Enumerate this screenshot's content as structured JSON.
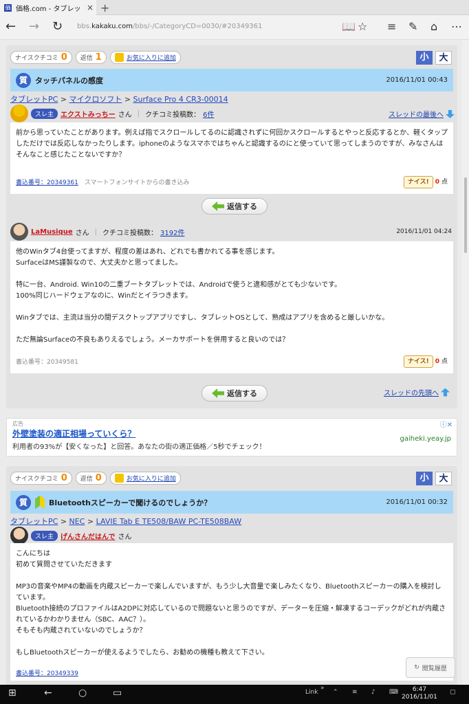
{
  "browser": {
    "tab_title": "価格.com - タブレットPCの",
    "favicon": "価",
    "tab_close": "×",
    "new_tab": "+",
    "url_prefix": "bbs.",
    "url_host": "kakaku.com",
    "url_path": "/bbs/-/CategoryCD=0030/#20349361"
  },
  "post1": {
    "nice_label": "ナイスクチコミ",
    "nice_count": "0",
    "reply_label": "返信",
    "reply_count": "1",
    "fav_label": "お気に入りに追加",
    "size_small": "小",
    "size_large": "大",
    "q_icon": "質",
    "title": "タッチパネルの感度",
    "date": "2016/11/01 00:43",
    "crumb": {
      "cat": "タブレットPC",
      "maker": "マイクロソフト",
      "product": "Surface Pro 4 CR3-00014",
      "sep": ">"
    },
    "author_badge": "スレ主",
    "author": "エクストみっちー",
    "san": "さん",
    "kuchikomi_label": "クチコミ投稿数：",
    "kuchikomi_count": "6件",
    "to_last": "スレッドの最後へ",
    "body": "前から思っていたことがあります。例えば指でスクロールしてるのに認識されずに何回かスクロールするとやっと反応するとか、軽くタップしただけでは反応しなかったりします。iphoneのようなスマホではちゃんと認識するのにと使っていて思ってしまうのですが、みなさんはそんなこと感じたことないですか？",
    "post_no": "書込番号：20349361",
    "post_via": "スマートフォンサイトからの書き込み",
    "nice_btn": "ナイス!",
    "nice_points": "0",
    "points_unit": "点",
    "reply_btn": "返信する"
  },
  "reply1": {
    "author": "LaMusique",
    "san": "さん",
    "kuchikomi_label": "クチコミ投稿数：",
    "kuchikomi_count": "3192件",
    "date": "2016/11/01 04:24",
    "lines": [
      "他のWinタブ4台使ってますが、程度の差はあれ、どれでも書かれてる事を感じます。",
      "SurfaceはMS謹製なので、大丈夫かと思ってました。",
      "",
      "特に一台、Android. Win10の二重ブートタブレットでは、Androidで使うと違和感がとても少ないです。",
      "100%同じハードウェアなのに、Winだとイラつきます。",
      "",
      "Winタブでは、主流は当分の間デスクトップアプリですし、タブレットOSとして、熟成はアプリを含めると厳しいかな。",
      "",
      "ただ無論Surfaceの不良もありえるでしょう。メーカサポートを併用すると良いのでは？"
    ],
    "post_no": "書込番号：20349581",
    "nice_btn": "ナイス!",
    "nice_points": "0",
    "points_unit": "点",
    "reply_btn": "返信する",
    "to_first": "スレッドの先頭へ"
  },
  "ad": {
    "label": "広告",
    "title": "外壁塗装の適正相場っていくら？",
    "desc": "利用者の93%が【安くなった】と回答。あなたの街の適正価格／5秒でチェック！",
    "url": "gaiheki.yeay.jp",
    "info": "ⓘ✕"
  },
  "post2": {
    "nice_label": "ナイスクチコミ",
    "nice_count": "0",
    "reply_label": "返信",
    "reply_count": "0",
    "fav_label": "お気に入りに追加",
    "size_small": "小",
    "size_large": "大",
    "q_icon": "質",
    "title": "Bluetoothスピーカーで聞けるのでしょうか？",
    "date": "2016/11/01 00:32",
    "crumb": {
      "cat": "タブレットPC",
      "maker": "NEC",
      "product": "LAVIE Tab E TE508/BAW PC-TE508BAW",
      "sep": ">"
    },
    "author_badge": "スレ主",
    "author": "げんさんだはんで",
    "san": "さん",
    "lines": [
      "こんにちは",
      "初めて質問させていただきます",
      "",
      "MP3の音楽やMP4の動画を内蔵スピーカーで楽しんでいますが、もう少し大音量で楽しみたくなり、Bluetoothスピーカーの購入を検討しています。",
      "Bluetooth接続のプロファイルはA2DPに対応しているので問題ないと思うのですが、データーを圧縮・解凍するコーデックがどれが内蔵されているかわかりません（SBC、AAC？）。",
      "そもそも内蔵されていないのでしょうか？",
      "",
      "もしBluetoothスピーカーが使えるようでしたら、お勧めの機種も教えて下さい。"
    ],
    "post_no": "書込番号：20349339"
  },
  "history_label": "閲覧履歴",
  "taskbar": {
    "link": "Link",
    "chevron": "»",
    "time": "6:47",
    "date": "2016/11/01"
  }
}
